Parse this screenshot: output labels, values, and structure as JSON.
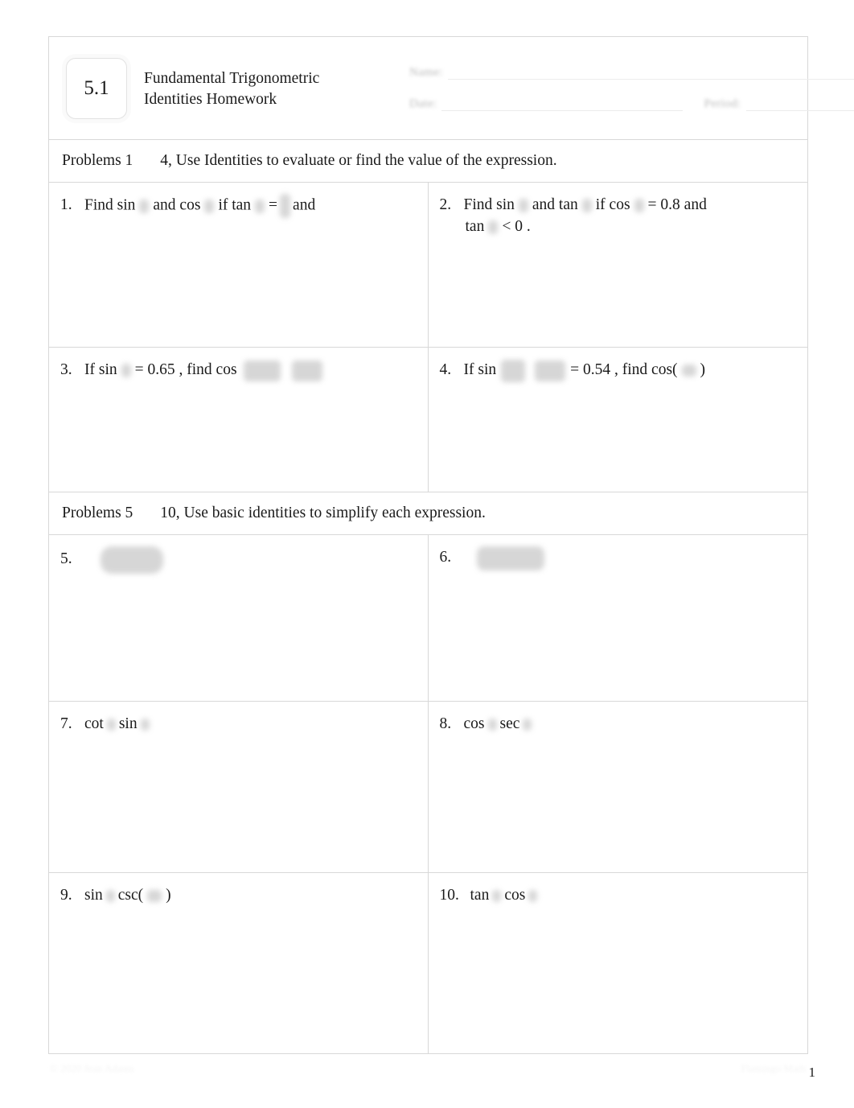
{
  "document": {
    "section_badge": "5.1",
    "title_line1": "Fundamental Trigonometric",
    "title_line2": "Identities Homework",
    "page_number": "1",
    "footer_left": "© 2020 Jean Adams",
    "footer_right": "Flamingo Math"
  },
  "header_fields": [
    {
      "label": "Name:"
    },
    {
      "label": "Date:"
    },
    {
      "label": "Period:"
    }
  ],
  "instructions": [
    {
      "prefix": "Problems 1",
      "suffix": "4, Use Identities to evaluate or find the value of the expression."
    },
    {
      "prefix": "Problems 5",
      "suffix": "10,  Use basic identities to simplify each expression."
    }
  ],
  "problems": [
    {
      "number": "1.",
      "text_parts": [
        "Find sin",
        "and cos",
        "if tan",
        "=",
        "and"
      ]
    },
    {
      "number": "2.",
      "text_parts": [
        "Find sin",
        "and  tan",
        "if cos",
        "= 0.8  and",
        "tan",
        "< 0 ."
      ]
    },
    {
      "number": "3.",
      "text_parts": [
        "If  sin",
        "= 0.65 , find  cos"
      ]
    },
    {
      "number": "4.",
      "text_parts": [
        "If  sin",
        "= 0.54 , find cos(",
        ")"
      ]
    },
    {
      "number": "5.",
      "text_parts": []
    },
    {
      "number": "6.",
      "text_parts": []
    },
    {
      "number": "7.",
      "text_parts": [
        "cot",
        "sin"
      ]
    },
    {
      "number": "8.",
      "text_parts": [
        "cos",
        "sec"
      ]
    },
    {
      "number": "9.",
      "text_parts": [
        "sin",
        "csc(",
        ")"
      ]
    },
    {
      "number": "10.",
      "text_parts": [
        "tan",
        "cos"
      ]
    }
  ]
}
